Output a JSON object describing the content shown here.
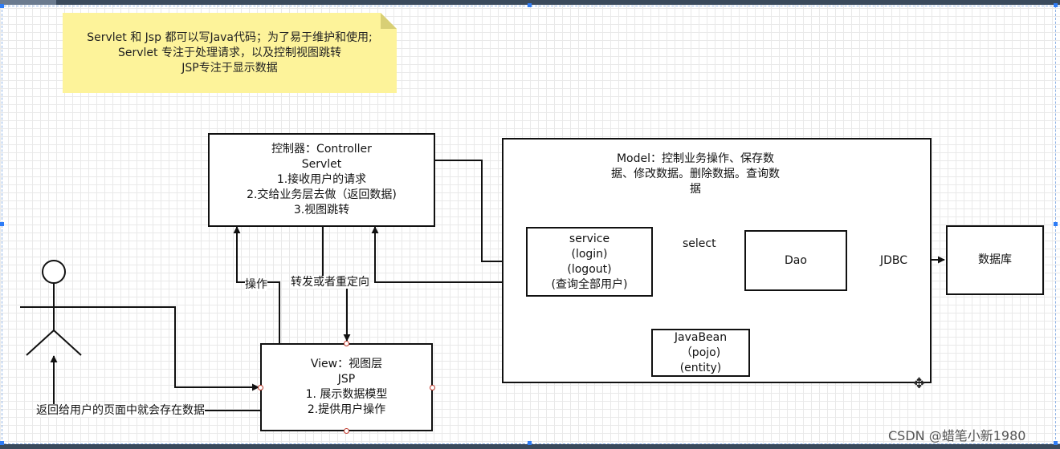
{
  "note": {
    "line1": "Servlet 和 Jsp  都可以写Java代码；为了易于维护和使用;",
    "line2": "Servlet 专注于处理请求，以及控制视图跳转",
    "line3": "JSP专注于显示数据"
  },
  "controller": {
    "line1": "控制器：Controller",
    "line2": "Servlet",
    "line3": "1.接收用户的请求",
    "line4": "2.交给业务层去做（返回数据)",
    "line5": "3.视图跳转"
  },
  "model": {
    "title": "Model：控制业务操作、保存数据、修改数据。删除数据。查询数据"
  },
  "service": {
    "line1": "service",
    "line2": "(login)",
    "line3": "(logout)",
    "line4": "(查询全部用户)"
  },
  "dao": {
    "label": "Dao"
  },
  "database": {
    "label": "数据库"
  },
  "javabean": {
    "line1": "JavaBean",
    "line2": "（pojo)",
    "line3": "(entity)"
  },
  "view": {
    "line1": "View：视图层",
    "line2": "JSP",
    "line3": "1. 展示数据模型",
    "line4": "2.提供用户操作"
  },
  "edges": {
    "select": "select",
    "jdbc": "JDBC",
    "operate": "操作",
    "forward": "转发或者重定向",
    "return_to_user": "返回给用户的页面中就会存在数据"
  },
  "watermark": "CSDN @蜡笔小新1980",
  "colors": {
    "note_fill": "#fdf39a",
    "stroke": "#111111",
    "port": "#c0392b",
    "frame": "#3a4a5c"
  }
}
